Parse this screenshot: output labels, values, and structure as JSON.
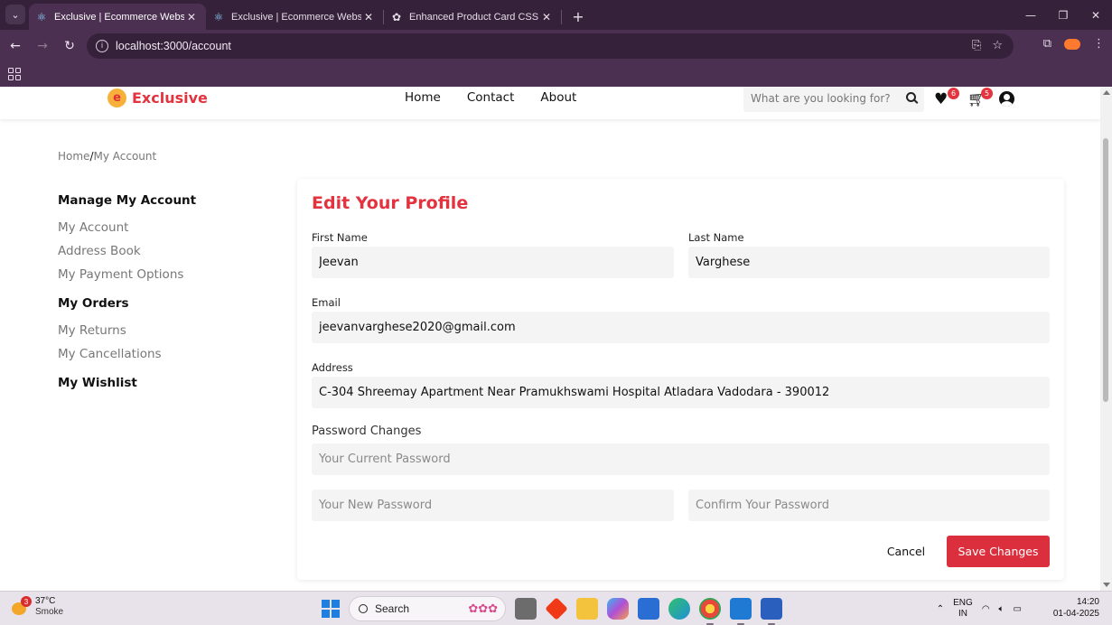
{
  "browser": {
    "tabs": [
      {
        "title": "Exclusive | Ecommerce Website",
        "active": true
      },
      {
        "title": "Exclusive | Ecommerce Website",
        "active": false
      },
      {
        "title": "Enhanced Product Card CSS - C",
        "active": false
      }
    ],
    "url": "localhost:3000/account"
  },
  "site": {
    "logo_text": "Exclusive",
    "nav": [
      "Home",
      "Contact",
      "About"
    ],
    "search_placeholder": "What are you looking for?",
    "wishlist_count": "6",
    "cart_count": "5"
  },
  "breadcrumb": {
    "home": "Home",
    "separator": "/",
    "current": "My Account"
  },
  "sidebar": {
    "groups": [
      {
        "heading": "Manage My Account",
        "links": [
          "My Account",
          "Address Book",
          "My Payment Options"
        ]
      },
      {
        "heading": "My Orders",
        "links": [
          "My Returns",
          "My Cancellations"
        ]
      },
      {
        "heading": "My Wishlist",
        "links": []
      }
    ]
  },
  "profile": {
    "title": "Edit Your Profile",
    "first_name_label": "First Name",
    "first_name": "Jeevan",
    "last_name_label": "Last Name",
    "last_name": "Varghese",
    "email_label": "Email",
    "email": "jeevanvarghese2020@gmail.com",
    "address_label": "Address",
    "address": "C-304 Shreemay Apartment Near Pramukhswami Hospital Atladara Vadodara - 390012",
    "password_heading": "Password Changes",
    "current_password_placeholder": "Your Current Password",
    "new_password_placeholder": "Your New Password",
    "confirm_password_placeholder": "Confirm Your Password",
    "cancel_label": "Cancel",
    "save_label": "Save Changes"
  },
  "taskbar": {
    "temperature": "37°C",
    "condition": "Smoke",
    "weather_alerts": "3",
    "search_label": "Search",
    "lang_top": "ENG",
    "lang_bottom": "IN",
    "time": "14:20",
    "date": "01-04-2025"
  },
  "colors": {
    "brand_red": "#db2f3e",
    "browser_dark": "#35213a",
    "browser_mid": "#4b3051"
  }
}
